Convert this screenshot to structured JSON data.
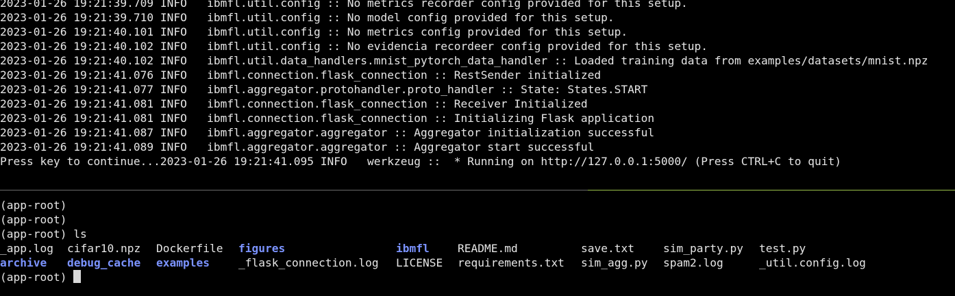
{
  "top_pane": {
    "lines": [
      "2023-01-26 19:21:39.709 INFO   ibmfl.util.config :: No metrics recorder config provided for this setup.",
      "2023-01-26 19:21:39.710 INFO   ibmfl.util.config :: No model config provided for this setup.",
      "2023-01-26 19:21:40.101 INFO   ibmfl.util.config :: No metrics config provided for this setup.",
      "2023-01-26 19:21:40.102 INFO   ibmfl.util.config :: No evidencia recordeer config provided for this setup.",
      "2023-01-26 19:21:40.102 INFO   ibmfl.util.data_handlers.mnist_pytorch_data_handler :: Loaded training data from examples/datasets/mnist.npz",
      "2023-01-26 19:21:41.076 INFO   ibmfl.connection.flask_connection :: RestSender initialized",
      "2023-01-26 19:21:41.077 INFO   ibmfl.aggregator.protohandler.proto_handler :: State: States.START",
      "2023-01-26 19:21:41.081 INFO   ibmfl.connection.flask_connection :: Receiver Initialized",
      "2023-01-26 19:21:41.081 INFO   ibmfl.connection.flask_connection :: Initializing Flask application",
      "2023-01-26 19:21:41.087 INFO   ibmfl.aggregator.aggregator :: Aggregator initialization successful",
      "2023-01-26 19:21:41.089 INFO   ibmfl.aggregator.aggregator :: Aggregator start successful",
      "Press key to continue...2023-01-26 19:21:41.095 INFO   werkzeug ::  * Running on http://127.0.0.1:5000/ (Press CTRL+C to quit)"
    ]
  },
  "colors": {
    "background": "#000000",
    "text": "#e6e6e6",
    "directory": "#7b93ff",
    "divider": "#6b6b6b",
    "divider_active": "#9bc34a",
    "cursor": "#d8d8d8"
  },
  "bottom_pane": {
    "prompt_lines": [
      "(app-root)",
      "(app-root)",
      "(app-root) ls"
    ],
    "ls_row1": [
      "_app.log",
      "cifar10.npz",
      "Dockerfile",
      "figures",
      "ibmfl",
      "README.md",
      "save.txt",
      "sim_party.py",
      "test.py"
    ],
    "ls_row2": [
      "archive",
      "debug_cache",
      "examples",
      "_flask_connection.log",
      "LICENSE",
      "requirements.txt",
      "sim_agg.py",
      "spam2.log",
      "_util.config.log"
    ],
    "final_prompt": "(app-root) "
  }
}
